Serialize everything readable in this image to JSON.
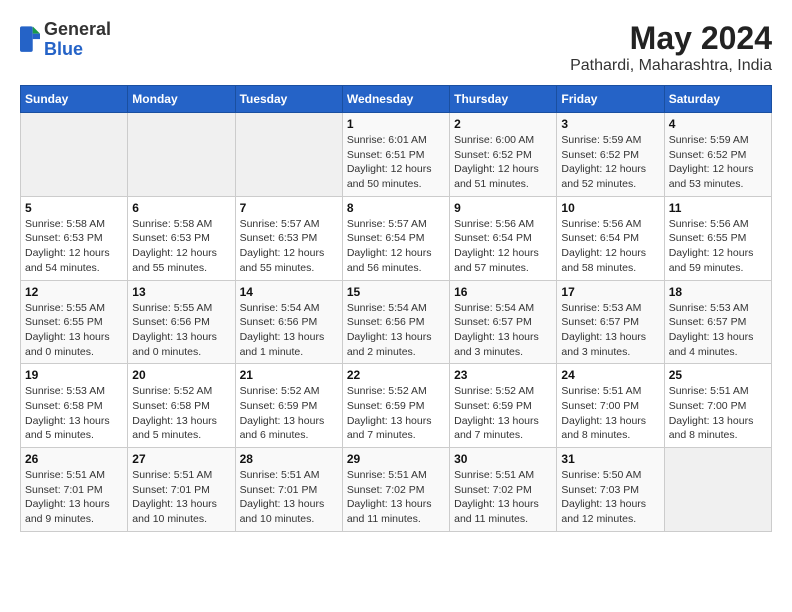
{
  "header": {
    "logo": {
      "line1": "General",
      "line2": "Blue"
    },
    "title": "May 2024",
    "subtitle": "Pathardi, Maharashtra, India"
  },
  "calendar": {
    "weekdays": [
      "Sunday",
      "Monday",
      "Tuesday",
      "Wednesday",
      "Thursday",
      "Friday",
      "Saturday"
    ],
    "weeks": [
      [
        {
          "day": "",
          "info": ""
        },
        {
          "day": "",
          "info": ""
        },
        {
          "day": "",
          "info": ""
        },
        {
          "day": "1",
          "info": "Sunrise: 6:01 AM\nSunset: 6:51 PM\nDaylight: 12 hours\nand 50 minutes."
        },
        {
          "day": "2",
          "info": "Sunrise: 6:00 AM\nSunset: 6:52 PM\nDaylight: 12 hours\nand 51 minutes."
        },
        {
          "day": "3",
          "info": "Sunrise: 5:59 AM\nSunset: 6:52 PM\nDaylight: 12 hours\nand 52 minutes."
        },
        {
          "day": "4",
          "info": "Sunrise: 5:59 AM\nSunset: 6:52 PM\nDaylight: 12 hours\nand 53 minutes."
        }
      ],
      [
        {
          "day": "5",
          "info": "Sunrise: 5:58 AM\nSunset: 6:53 PM\nDaylight: 12 hours\nand 54 minutes."
        },
        {
          "day": "6",
          "info": "Sunrise: 5:58 AM\nSunset: 6:53 PM\nDaylight: 12 hours\nand 55 minutes."
        },
        {
          "day": "7",
          "info": "Sunrise: 5:57 AM\nSunset: 6:53 PM\nDaylight: 12 hours\nand 55 minutes."
        },
        {
          "day": "8",
          "info": "Sunrise: 5:57 AM\nSunset: 6:54 PM\nDaylight: 12 hours\nand 56 minutes."
        },
        {
          "day": "9",
          "info": "Sunrise: 5:56 AM\nSunset: 6:54 PM\nDaylight: 12 hours\nand 57 minutes."
        },
        {
          "day": "10",
          "info": "Sunrise: 5:56 AM\nSunset: 6:54 PM\nDaylight: 12 hours\nand 58 minutes."
        },
        {
          "day": "11",
          "info": "Sunrise: 5:56 AM\nSunset: 6:55 PM\nDaylight: 12 hours\nand 59 minutes."
        }
      ],
      [
        {
          "day": "12",
          "info": "Sunrise: 5:55 AM\nSunset: 6:55 PM\nDaylight: 13 hours\nand 0 minutes."
        },
        {
          "day": "13",
          "info": "Sunrise: 5:55 AM\nSunset: 6:56 PM\nDaylight: 13 hours\nand 0 minutes."
        },
        {
          "day": "14",
          "info": "Sunrise: 5:54 AM\nSunset: 6:56 PM\nDaylight: 13 hours\nand 1 minute."
        },
        {
          "day": "15",
          "info": "Sunrise: 5:54 AM\nSunset: 6:56 PM\nDaylight: 13 hours\nand 2 minutes."
        },
        {
          "day": "16",
          "info": "Sunrise: 5:54 AM\nSunset: 6:57 PM\nDaylight: 13 hours\nand 3 minutes."
        },
        {
          "day": "17",
          "info": "Sunrise: 5:53 AM\nSunset: 6:57 PM\nDaylight: 13 hours\nand 3 minutes."
        },
        {
          "day": "18",
          "info": "Sunrise: 5:53 AM\nSunset: 6:57 PM\nDaylight: 13 hours\nand 4 minutes."
        }
      ],
      [
        {
          "day": "19",
          "info": "Sunrise: 5:53 AM\nSunset: 6:58 PM\nDaylight: 13 hours\nand 5 minutes."
        },
        {
          "day": "20",
          "info": "Sunrise: 5:52 AM\nSunset: 6:58 PM\nDaylight: 13 hours\nand 5 minutes."
        },
        {
          "day": "21",
          "info": "Sunrise: 5:52 AM\nSunset: 6:59 PM\nDaylight: 13 hours\nand 6 minutes."
        },
        {
          "day": "22",
          "info": "Sunrise: 5:52 AM\nSunset: 6:59 PM\nDaylight: 13 hours\nand 7 minutes."
        },
        {
          "day": "23",
          "info": "Sunrise: 5:52 AM\nSunset: 6:59 PM\nDaylight: 13 hours\nand 7 minutes."
        },
        {
          "day": "24",
          "info": "Sunrise: 5:51 AM\nSunset: 7:00 PM\nDaylight: 13 hours\nand 8 minutes."
        },
        {
          "day": "25",
          "info": "Sunrise: 5:51 AM\nSunset: 7:00 PM\nDaylight: 13 hours\nand 8 minutes."
        }
      ],
      [
        {
          "day": "26",
          "info": "Sunrise: 5:51 AM\nSunset: 7:01 PM\nDaylight: 13 hours\nand 9 minutes."
        },
        {
          "day": "27",
          "info": "Sunrise: 5:51 AM\nSunset: 7:01 PM\nDaylight: 13 hours\nand 10 minutes."
        },
        {
          "day": "28",
          "info": "Sunrise: 5:51 AM\nSunset: 7:01 PM\nDaylight: 13 hours\nand 10 minutes."
        },
        {
          "day": "29",
          "info": "Sunrise: 5:51 AM\nSunset: 7:02 PM\nDaylight: 13 hours\nand 11 minutes."
        },
        {
          "day": "30",
          "info": "Sunrise: 5:51 AM\nSunset: 7:02 PM\nDaylight: 13 hours\nand 11 minutes."
        },
        {
          "day": "31",
          "info": "Sunrise: 5:50 AM\nSunset: 7:03 PM\nDaylight: 13 hours\nand 12 minutes."
        },
        {
          "day": "",
          "info": ""
        }
      ]
    ]
  }
}
